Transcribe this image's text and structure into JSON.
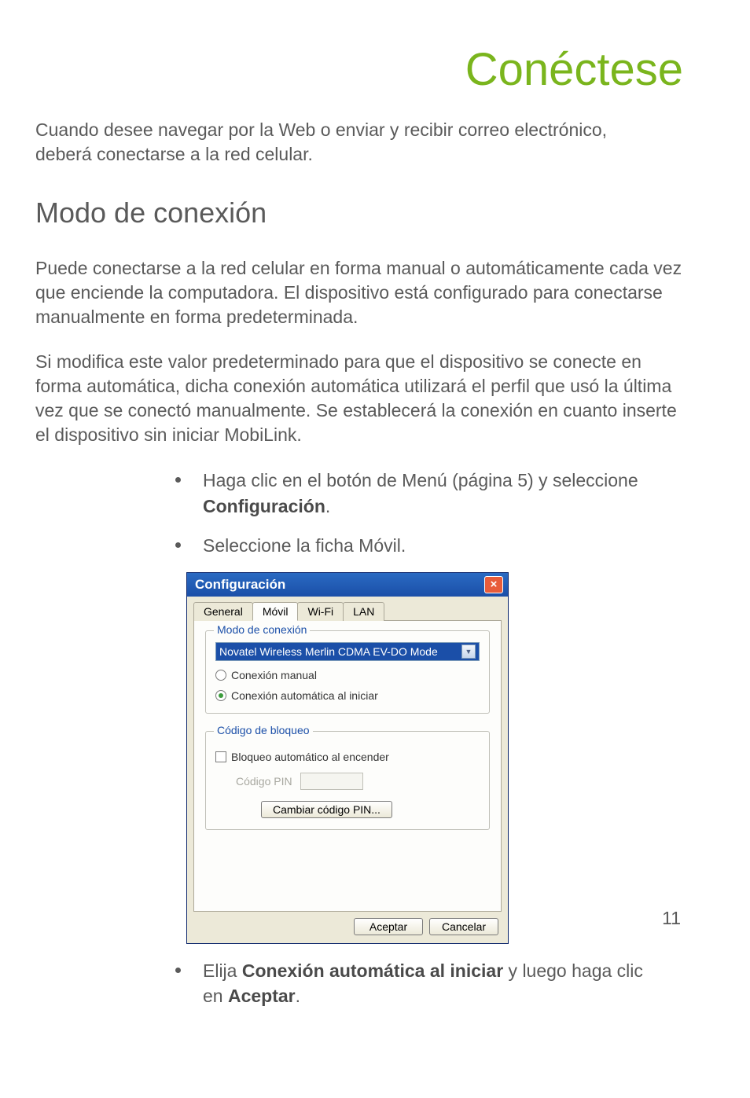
{
  "page": {
    "title": "Conéctese",
    "intro": "Cuando desee navegar por la Web o enviar y recibir correo electrónico, deberá conectarse a la red celular.",
    "section_heading": "Modo de conexión",
    "para1": "Puede conectarse a la red celular en forma manual o automáticamente cada vez que enciende la computadora. El dispositivo está configurado para conectarse manualmente en forma predeterminada.",
    "para2": "Si modifica este valor predeterminado para que el dispositivo se conecte en forma automática, dicha conexión automática utilizará el perfil que usó la última vez que se conectó manualmente. Se establecerá la conexión en cuanto inserte el dispositivo sin iniciar MobiLink.",
    "number": "11"
  },
  "bullets": {
    "b1_pre": "Haga clic en el botón de Menú (página 5) y seleccione ",
    "b1_bold": "Configuración",
    "b1_post": ".",
    "b2": "Seleccione la ficha Móvil.",
    "b3_pre": "Elija ",
    "b3_bold1": "Conexión automática al iniciar",
    "b3_mid": " y luego haga clic en ",
    "b3_bold2": "Aceptar",
    "b3_post": "."
  },
  "dialog": {
    "title": "Configuración",
    "tabs": {
      "general": "General",
      "movil": "Móvil",
      "wifi": "Wi-Fi",
      "lan": "LAN"
    },
    "grp1": {
      "legend": "Modo de conexión",
      "select": "Novatel Wireless Merlin CDMA EV-DO Mode",
      "radio_manual": "Conexión manual",
      "radio_auto": "Conexión automática al iniciar"
    },
    "grp2": {
      "legend": "Código de bloqueo",
      "check_autolock": "Bloqueo automático al encender",
      "pin_label": "Código PIN",
      "btn_change_pin": "Cambiar código PIN..."
    },
    "buttons": {
      "ok": "Aceptar",
      "cancel": "Cancelar"
    }
  }
}
